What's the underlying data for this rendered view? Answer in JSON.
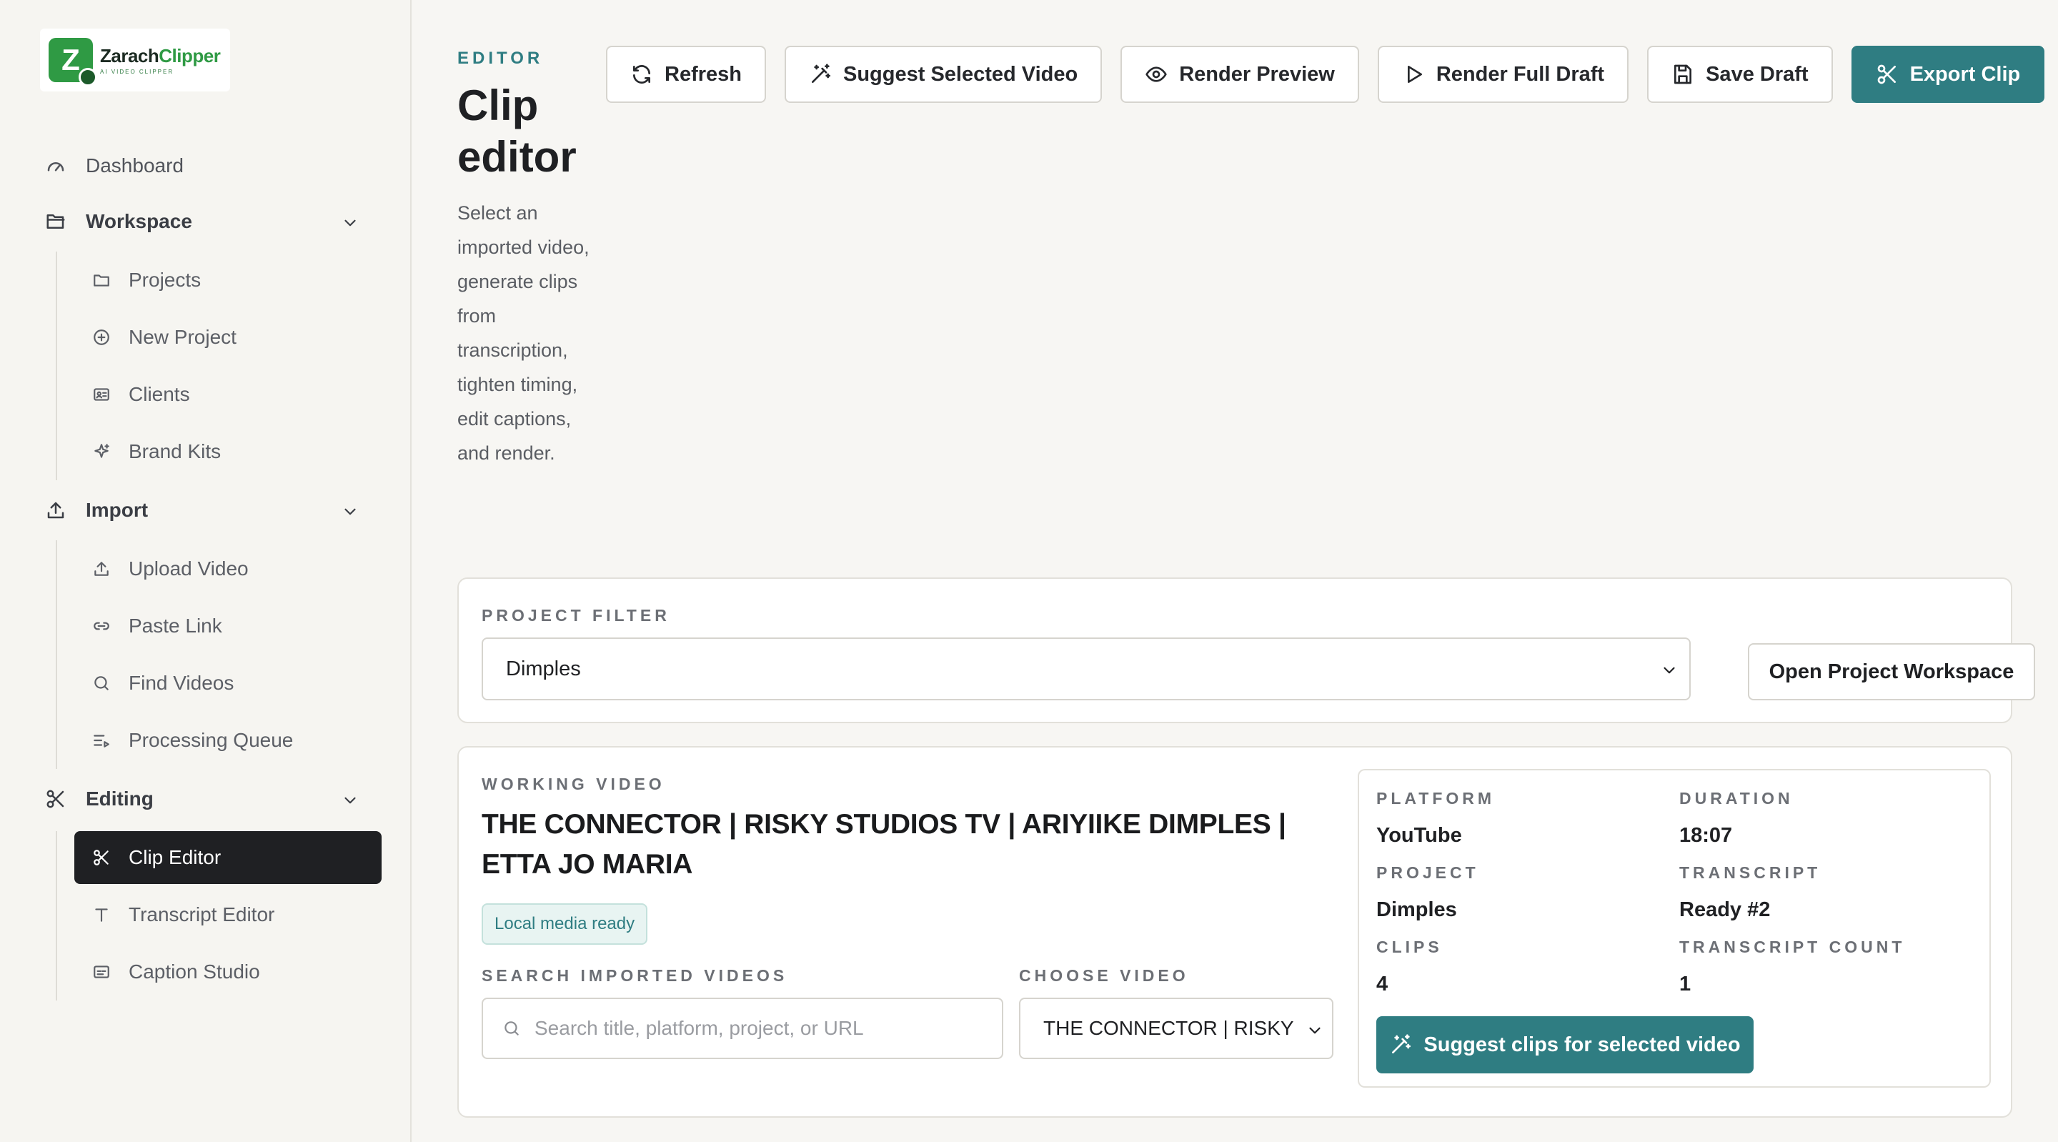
{
  "brand": {
    "name_part1": "Zarach",
    "name_part2": "Clipper",
    "tagline": "AI VIDEO CLIPPER",
    "mark_letter": "Z",
    "accent_color": "#2f9a44"
  },
  "sidebar": {
    "dashboard": "Dashboard",
    "workspace": {
      "label": "Workspace",
      "items": [
        "Projects",
        "New Project",
        "Clients",
        "Brand Kits"
      ]
    },
    "import": {
      "label": "Import",
      "items": [
        "Upload Video",
        "Paste Link",
        "Find Videos",
        "Processing Queue"
      ]
    },
    "editing": {
      "label": "Editing",
      "items": [
        "Clip Editor",
        "Transcript Editor",
        "Caption Studio"
      ],
      "active_item": "Clip Editor"
    }
  },
  "header": {
    "eyebrow": "EDITOR",
    "title": "Clip editor",
    "description": "Select an imported video, generate clips from transcription, tighten timing, edit captions, and render."
  },
  "toolbar": {
    "refresh": "Refresh",
    "suggest_selected": "Suggest Selected Video",
    "render_preview": "Render Preview",
    "render_full": "Render Full Draft",
    "save_draft": "Save Draft",
    "export_clip": "Export Clip"
  },
  "project_filter": {
    "label": "PROJECT FILTER",
    "selected": "Dimples",
    "open_button": "Open Project Workspace"
  },
  "working_video": {
    "label": "WORKING VIDEO",
    "title": "THE CONNECTOR | RISKY STUDIOS TV | ARIYIIKE DIMPLES | ETTA JO MARIA",
    "badge": "Local media ready",
    "search_label": "SEARCH IMPORTED VIDEOS",
    "search_placeholder": "Search title, platform, project, or URL",
    "search_value": "",
    "choose_label": "CHOOSE VIDEO",
    "choose_selected": "THE CONNECTOR | RISKY STUDIOS TV | ARIYIIKE DIMPLES | ETTA JO MARIA"
  },
  "meta": {
    "platform_label": "PLATFORM",
    "platform": "YouTube",
    "duration_label": "DURATION",
    "duration": "18:07",
    "project_label": "PROJECT",
    "project": "Dimples",
    "transcript_label": "TRANSCRIPT",
    "transcript": "Ready #2",
    "clips_label": "CLIPS",
    "clips": "4",
    "transcript_count_label": "TRANSCRIPT COUNT",
    "transcript_count": "1",
    "suggest_button": "Suggest clips for selected video"
  },
  "colors": {
    "primary": "#2f7d82",
    "active_nav": "#1f2023",
    "background": "#f7f6f3"
  }
}
